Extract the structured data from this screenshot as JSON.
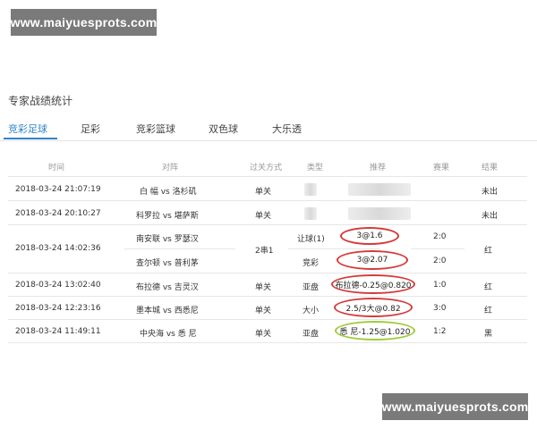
{
  "watermark": {
    "text": "www.maiyuesprots.com"
  },
  "page": {
    "title": "专家战绩统计"
  },
  "tabs": [
    {
      "label": "竞彩足球",
      "active": true
    },
    {
      "label": "足彩"
    },
    {
      "label": "竞彩篮球"
    },
    {
      "label": "双色球"
    },
    {
      "label": "大乐透"
    }
  ],
  "table": {
    "headers": [
      "时间",
      "对阵",
      "过关方式",
      "类型",
      "推荐",
      "赛果",
      "结果"
    ],
    "rows": [
      {
        "time": "2018-03-24 21:07:19",
        "match": "白 幅 vs 洛杉矶",
        "mode": "单关",
        "type": "",
        "pick": "",
        "score": "",
        "result": "未出"
      },
      {
        "time": "2018-03-24 20:10:27",
        "match": "科罗拉 vs 堪萨斯",
        "mode": "单关",
        "type": "",
        "pick": "",
        "score": "",
        "result": "未出"
      },
      {
        "time": "2018-03-24 14:02:36",
        "match": "南安联 vs 罗瑟汉",
        "mode": "2串1",
        "type": "让球(1)",
        "pick": "3@1.6",
        "score": "2:0",
        "result": "红"
      },
      {
        "time": "",
        "match": "查尔顿 vs 普利茅",
        "mode": "",
        "type": "竞彩",
        "pick": "3@2.07",
        "score": "2:0",
        "result": ""
      },
      {
        "time": "2018-03-24 13:02:40",
        "match": "布拉德 vs 吉灵汉",
        "mode": "单关",
        "type": "亚盘",
        "pick": "布拉德-0.25@0.820",
        "score": "1:0",
        "result": "红"
      },
      {
        "time": "2018-03-24 12:23:16",
        "match": "墨本城 vs 西悉尼",
        "mode": "单关",
        "type": "大小",
        "pick": "2.5/3大@0.82",
        "score": "3:0",
        "result": "红"
      },
      {
        "time": "2018-03-24 11:49:11",
        "match": "中央海 vs 悉 尼",
        "mode": "单关",
        "type": "亚盘",
        "pick": "悉 尼-1.25@1.020",
        "score": "1:2",
        "result": "黑"
      }
    ]
  },
  "colors": {
    "accent": "#2f83c8",
    "circle_red": "#d43a3a",
    "circle_green": "#9ecb3a"
  }
}
